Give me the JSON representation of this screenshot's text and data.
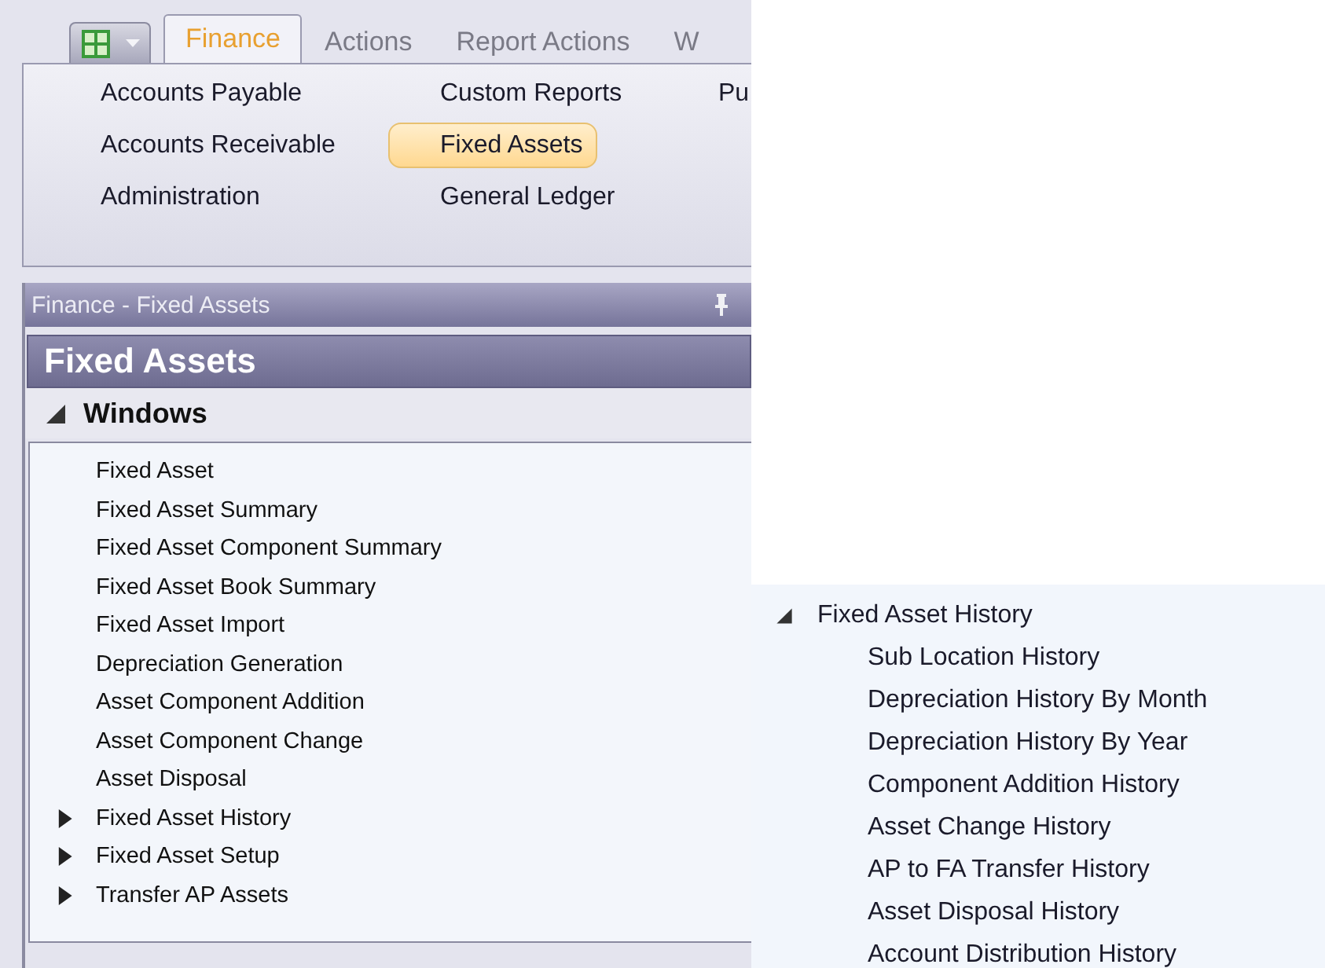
{
  "ribbon": {
    "tabs": [
      {
        "label": "Finance",
        "selected": true
      },
      {
        "label": "Actions",
        "selected": false
      },
      {
        "label": "Report Actions",
        "selected": false
      },
      {
        "label": "W",
        "selected": false
      }
    ],
    "columns": [
      [
        {
          "label": "Accounts Payable",
          "selected": false
        },
        {
          "label": "Accounts Receivable",
          "selected": false
        },
        {
          "label": "Administration",
          "selected": false
        }
      ],
      [
        {
          "label": "Custom Reports",
          "selected": false
        },
        {
          "label": "Fixed Assets",
          "selected": true
        },
        {
          "label": "General Ledger",
          "selected": false
        }
      ],
      [
        {
          "label": "Pu",
          "selected": false
        }
      ]
    ]
  },
  "panel": {
    "title": "Finance - Fixed Assets",
    "heading": "Fixed Assets",
    "section": {
      "label": "Windows",
      "expanded": true,
      "items": [
        {
          "label": "Fixed Asset",
          "kind": "window"
        },
        {
          "label": "Fixed Asset Summary",
          "kind": "window"
        },
        {
          "label": "Fixed Asset Component Summary",
          "kind": "window"
        },
        {
          "label": "Fixed Asset Book Summary",
          "kind": "window"
        },
        {
          "label": "Fixed Asset Import",
          "kind": "window"
        },
        {
          "label": "Depreciation Generation",
          "kind": "window"
        },
        {
          "label": "Asset Component Addition",
          "kind": "window"
        },
        {
          "label": "Asset Component Change",
          "kind": "window"
        },
        {
          "label": "Asset Disposal",
          "kind": "window"
        },
        {
          "label": "Fixed Asset History",
          "kind": "folder",
          "expanded": false
        },
        {
          "label": "Fixed Asset Setup",
          "kind": "folder",
          "expanded": false
        },
        {
          "label": "Transfer AP Assets",
          "kind": "folder",
          "expanded": false
        }
      ]
    }
  },
  "inset": {
    "items": [
      {
        "label": "Fixed Asset History",
        "kind": "folder",
        "expanded": true,
        "children": [
          {
            "label": "Sub Location History",
            "kind": "window"
          },
          {
            "label": "Depreciation History By Month",
            "kind": "window"
          },
          {
            "label": "Depreciation History By Year",
            "kind": "window"
          },
          {
            "label": "Component Addition History",
            "kind": "window"
          },
          {
            "label": "Asset Change History",
            "kind": "window"
          },
          {
            "label": "AP to FA Transfer History",
            "kind": "window"
          },
          {
            "label": "Asset Disposal History",
            "kind": "window"
          },
          {
            "label": "Account Distribution History",
            "kind": "window"
          }
        ]
      }
    ]
  }
}
